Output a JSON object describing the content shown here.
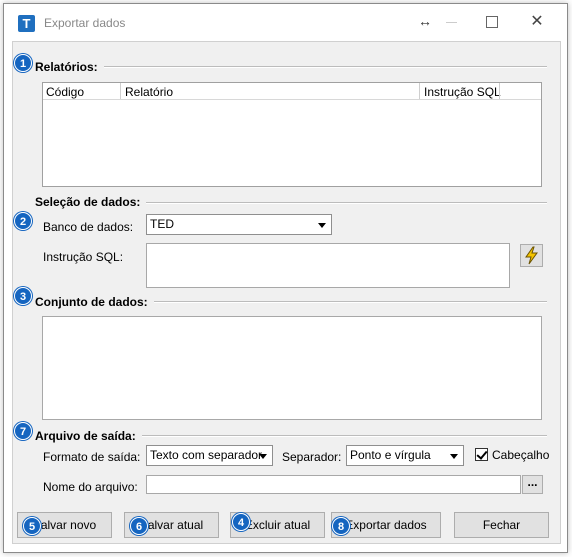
{
  "window": {
    "title": "Exportar dados",
    "close_glyph": "✕",
    "resize_glyph": "↔",
    "app_icon_letter": "T"
  },
  "relatorios": {
    "label": "Relatórios:",
    "columns": [
      "Código",
      "Relatório",
      "Instrução SQL"
    ]
  },
  "selecao": {
    "label": "Seleção de dados:",
    "banco_label": "Banco de dados:",
    "banco_value": "TED",
    "sql_label": "Instrução SQL:",
    "sql_value": ""
  },
  "conjunto": {
    "label": "Conjunto de dados:"
  },
  "arquivo": {
    "label": "Arquivo de saída:",
    "formato_label": "Formato de saída:",
    "formato_value": "Texto com separador",
    "separador_label": "Separador:",
    "separador_value": "Ponto e vírgula",
    "cabecalho_label": "Cabeçalho",
    "cabecalho_checked": true,
    "nome_label": "Nome do arquivo:",
    "nome_value": "",
    "browse_label": "..."
  },
  "buttons": {
    "salvar_novo": "Salvar novo",
    "salvar_atual": "Salvar atual",
    "excluir_atual": "Excluir atual",
    "exportar": "Exportar dados",
    "fechar": "Fechar"
  },
  "badges": [
    "1",
    "2",
    "3",
    "7",
    "5",
    "6",
    "4",
    "8"
  ],
  "colors": {
    "badge": "#1565c0",
    "panel": "#f0f0f0",
    "lightning": "#f5c400"
  }
}
